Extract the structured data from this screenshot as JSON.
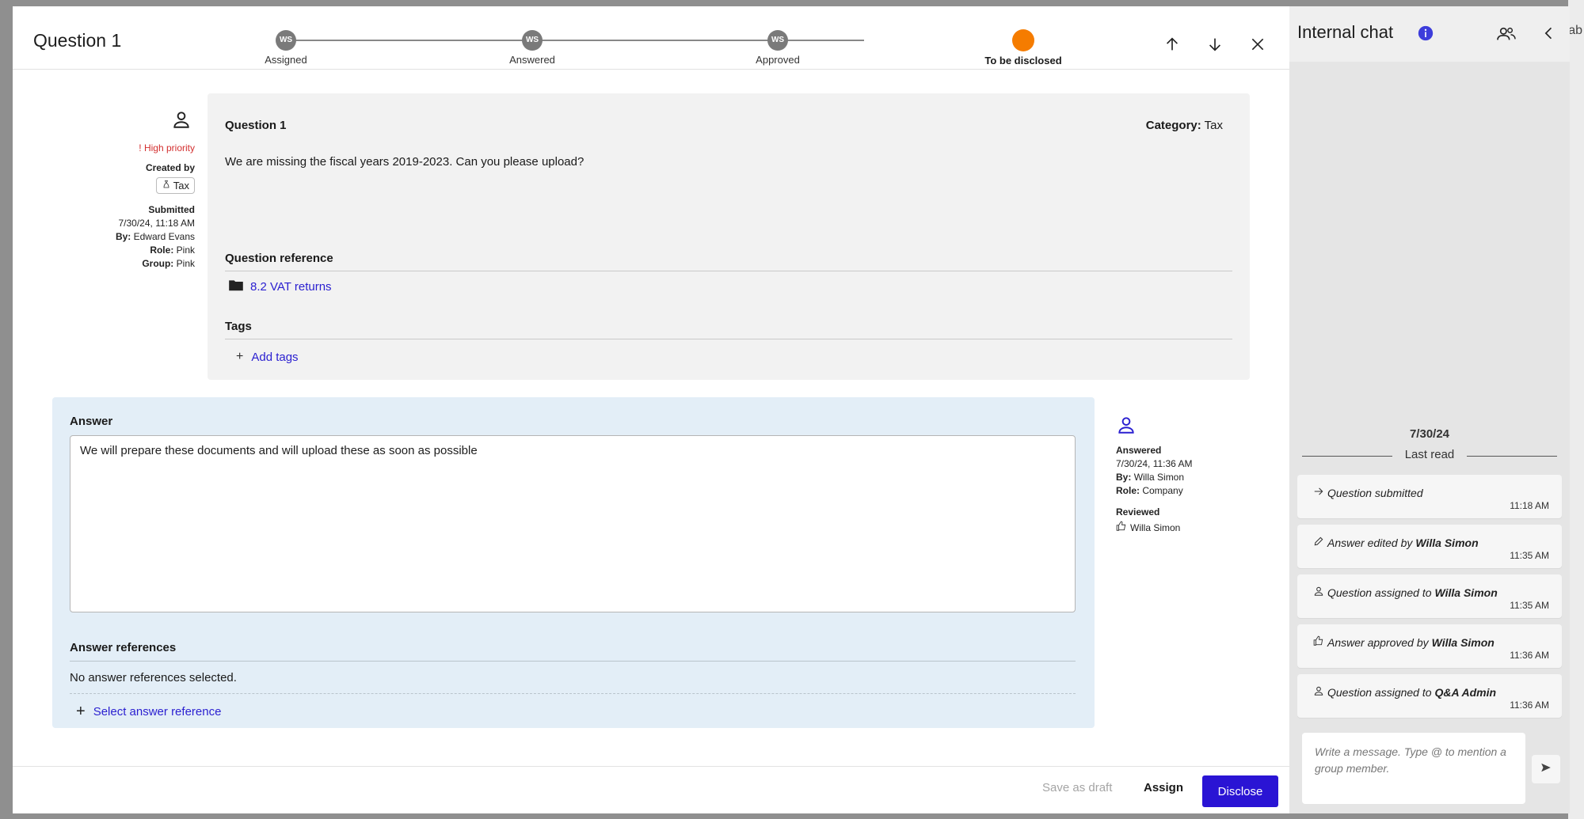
{
  "background": {
    "partial_text": "ab"
  },
  "modal": {
    "title": "Question 1",
    "steps": [
      {
        "label": "Assigned",
        "initials": "WS"
      },
      {
        "label": "Answered",
        "initials": "WS"
      },
      {
        "label": "Approved",
        "initials": "WS"
      },
      {
        "label": "To be disclosed",
        "initials": ""
      }
    ],
    "header_icons": [
      "arrow-up-icon",
      "arrow-down-icon",
      "close-icon"
    ]
  },
  "meta": {
    "priority": "High priority",
    "created_by_label": "Created by",
    "created_by_tag": "Tax",
    "submitted_label": "Submitted",
    "submitted_at": "7/30/24, 11:18 AM",
    "by_label": "By:",
    "by": "Edward Evans",
    "role_label": "Role:",
    "role": "Pink",
    "group_label": "Group:",
    "group": "Pink"
  },
  "question": {
    "title": "Question 1",
    "category_label": "Category:",
    "category": "Tax",
    "text": "We are missing the fiscal years 2019-2023. Can you please upload?",
    "reference_heading": "Question reference",
    "reference_link": "8.2 VAT returns",
    "tags_heading": "Tags",
    "add_tags": "Add tags"
  },
  "answer": {
    "heading": "Answer",
    "text": "We will prepare these documents and will upload these as soon as possible",
    "references_heading": "Answer references",
    "no_references": "No answer references selected.",
    "select_reference": "Select answer reference"
  },
  "answered_meta": {
    "answered_label": "Answered",
    "answered_at": "7/30/24, 11:36 AM",
    "by_label": "By:",
    "by": "Willa Simon",
    "role_label": "Role:",
    "role": "Company",
    "reviewed_label": "Reviewed",
    "reviewed_by": "Willa Simon"
  },
  "footer": {
    "save_draft": "Save as draft",
    "assign": "Assign",
    "disclose": "Disclose"
  },
  "chat": {
    "title": "Internal chat",
    "date": "7/30/24",
    "last_read": "Last read",
    "events": [
      {
        "icon": "arrow-right-icon",
        "text": "Question submitted",
        "who": "",
        "time": "11:18 AM"
      },
      {
        "icon": "pencil-icon",
        "text": "Answer edited by",
        "who": "Willa Simon",
        "time": "11:35 AM"
      },
      {
        "icon": "person-icon",
        "text": "Question assigned to",
        "who": "Willa Simon",
        "time": "11:35 AM"
      },
      {
        "icon": "thumbs-up-icon",
        "text": "Answer approved by",
        "who": "Willa Simon",
        "time": "11:36 AM"
      },
      {
        "icon": "person-icon",
        "text": "Question assigned to",
        "who": "Q&A Admin",
        "time": "11:36 AM"
      }
    ],
    "message_placeholder": "Write a message. Type @ to mention a group member."
  },
  "colors": {
    "accent": "#2a14d4",
    "link": "#2a1fd0",
    "current_step": "#f57c00",
    "priority": "#d32f2f",
    "answer_bg": "#e3eef7"
  }
}
